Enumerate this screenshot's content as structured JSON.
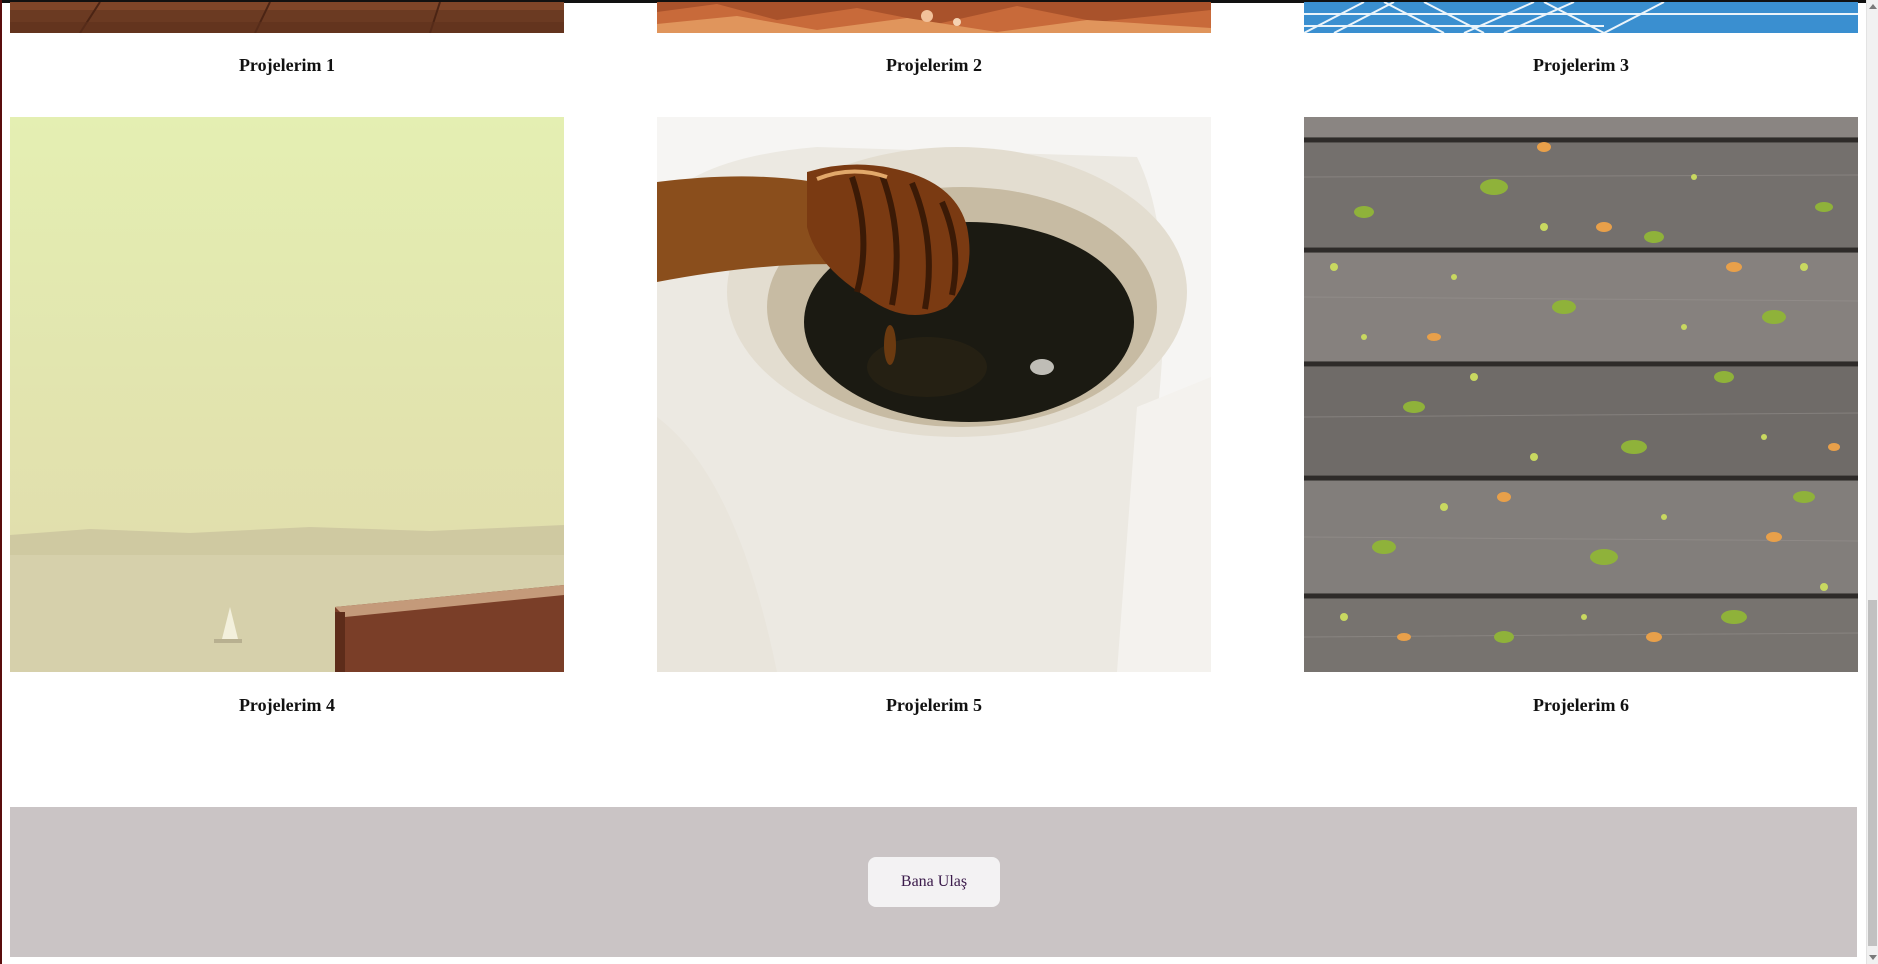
{
  "projects": [
    {
      "caption": "Projelerim 1",
      "image": "wooden-planks-photo"
    },
    {
      "caption": "Projelerim 2",
      "image": "red-rocks-photo"
    },
    {
      "caption": "Projelerim 3",
      "image": "ferris-wheel-sky-photo"
    },
    {
      "caption": "Projelerim 4",
      "image": "hazy-sea-rooftop-photo"
    },
    {
      "caption": "Projelerim 5",
      "image": "honey-dipper-jar-photo"
    },
    {
      "caption": "Projelerim 6",
      "image": "leaves-on-wood-deck-photo"
    }
  ],
  "footer": {
    "contact_button": "Bana Ulaş"
  },
  "colors": {
    "footer_bg": "#cac4c5",
    "button_bg": "#f3f2f3",
    "button_text": "#3a1a4a"
  }
}
